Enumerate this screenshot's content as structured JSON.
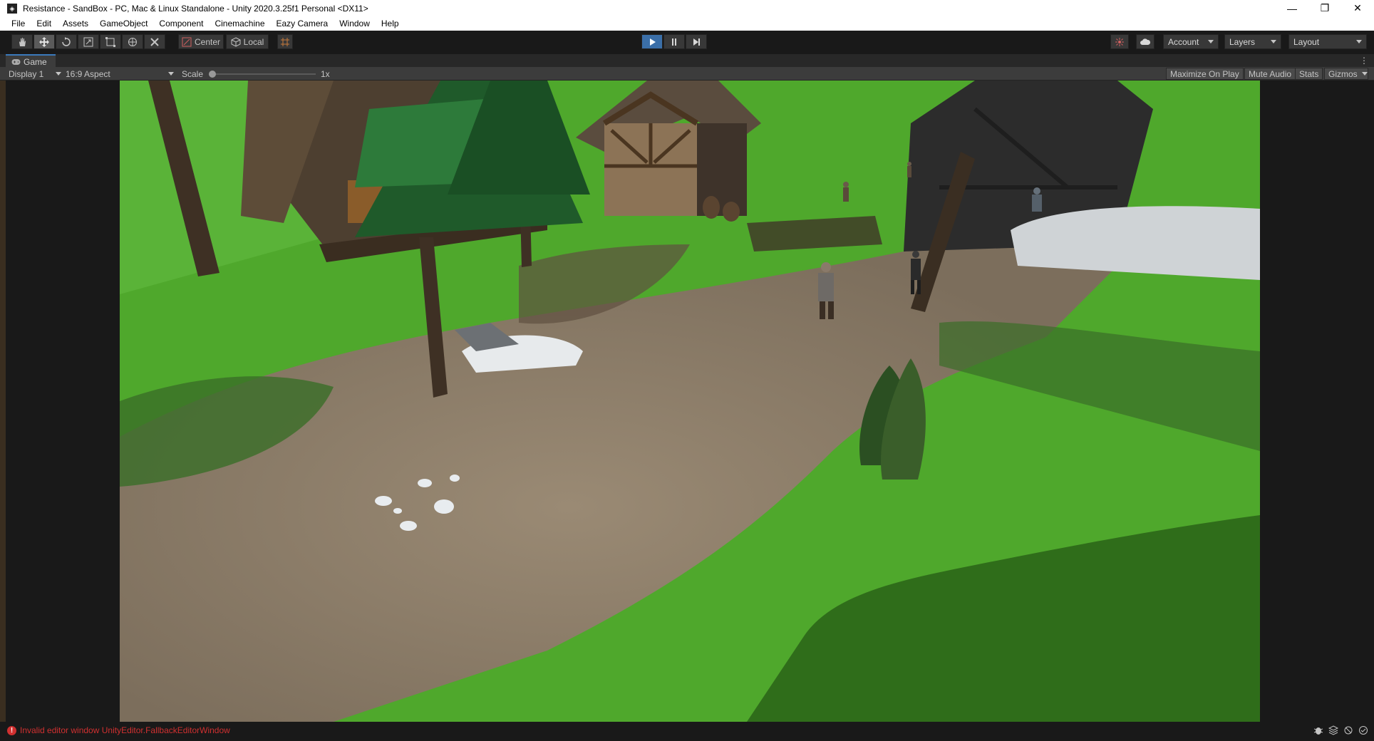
{
  "window": {
    "title": "Resistance - SandBox - PC, Mac & Linux Standalone - Unity 2020.3.25f1 Personal <DX11>",
    "minimize": "—",
    "restore": "❐",
    "close": "✕"
  },
  "menu": [
    "File",
    "Edit",
    "Assets",
    "GameObject",
    "Component",
    "Cinemachine",
    "Eazy Camera",
    "Window",
    "Help"
  ],
  "toolbar": {
    "pivot_label": "Center",
    "space_label": "Local",
    "account_label": "Account",
    "layers_label": "Layers",
    "layout_label": "Layout"
  },
  "game_tab": {
    "label": "Game"
  },
  "game_bar": {
    "display": "Display 1",
    "aspect": "16:9 Aspect",
    "scale_label": "Scale",
    "scale_value": "1x",
    "scale_fraction": 0.0,
    "maximize": "Maximize On Play",
    "mute": "Mute Audio",
    "stats": "Stats",
    "gizmos": "Gizmos"
  },
  "status": {
    "error": "Invalid editor window UnityEditor.FallbackEditorWindow"
  },
  "colors": {
    "accent": "#3b6fa8",
    "error": "#d03030",
    "grass": "#4fa82c",
    "dirt": "#8a7a66",
    "sky": "#1e3f7a"
  }
}
